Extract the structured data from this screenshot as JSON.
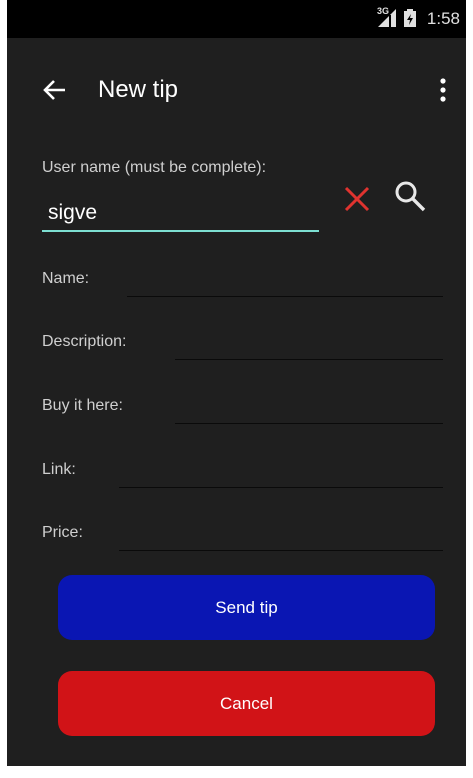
{
  "status_bar": {
    "time": "1:58",
    "network": "3G"
  },
  "app_bar": {
    "title": "New tip"
  },
  "user_name": {
    "label": "User name (must be complete):",
    "value": "sigve"
  },
  "fields": [
    {
      "label": "Name:",
      "value": ""
    },
    {
      "label": "Description:",
      "value": ""
    },
    {
      "label": "Buy it here:",
      "value": ""
    },
    {
      "label": "Link:",
      "value": ""
    },
    {
      "label": "Price:",
      "value": ""
    }
  ],
  "buttons": {
    "send_label": "Send tip",
    "cancel_label": "Cancel"
  },
  "colors": {
    "background": "#1f1f1f",
    "accent": "#7ddfd2",
    "send": "#0a16b3",
    "cancel": "#d11317",
    "clear_icon": "#e0332f"
  },
  "icons": {
    "back": "arrow-left-icon",
    "overflow": "more-vertical-icon",
    "clear": "close-icon",
    "search": "search-icon",
    "battery": "battery-icon",
    "signal": "signal-icon"
  }
}
